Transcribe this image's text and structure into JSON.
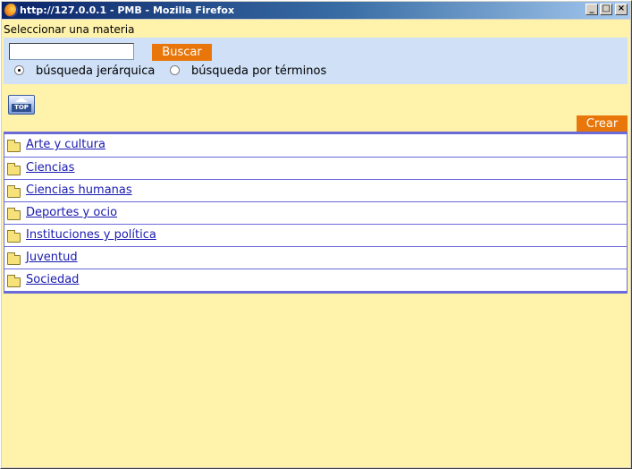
{
  "window": {
    "title": "http://127.0.0.1 - PMB - Mozilla Firefox",
    "app_icon": "firefox-icon",
    "controls": {
      "minimize": "_",
      "maximize": "□",
      "close": "×"
    }
  },
  "page": {
    "title": "Seleccionar una materia"
  },
  "search": {
    "input_value": "",
    "button_label": "Buscar",
    "options": [
      {
        "label": "búsqueda jerárquica",
        "checked": true
      },
      {
        "label": "búsqueda por términos",
        "checked": false
      }
    ]
  },
  "top_icon": {
    "label": "TOP",
    "icon": "top-arrow-icon"
  },
  "create_button": {
    "label": "Crear"
  },
  "categories": [
    {
      "label": "Arte y cultura",
      "icon": "folder-icon"
    },
    {
      "label": "Ciencias",
      "icon": "folder-icon"
    },
    {
      "label": "Ciencias humanas",
      "icon": "folder-icon"
    },
    {
      "label": "Deportes y ocio",
      "icon": "folder-icon"
    },
    {
      "label": "Instituciones y política",
      "icon": "folder-icon"
    },
    {
      "label": "Juventud",
      "icon": "folder-icon"
    },
    {
      "label": "Sociedad",
      "icon": "folder-icon"
    }
  ],
  "colors": {
    "page_background": "#fff2ab",
    "search_panel": "#cfe0f7",
    "accent_button": "#e8760a",
    "link": "#1a1ab0",
    "list_border": "#6a6ad8"
  }
}
